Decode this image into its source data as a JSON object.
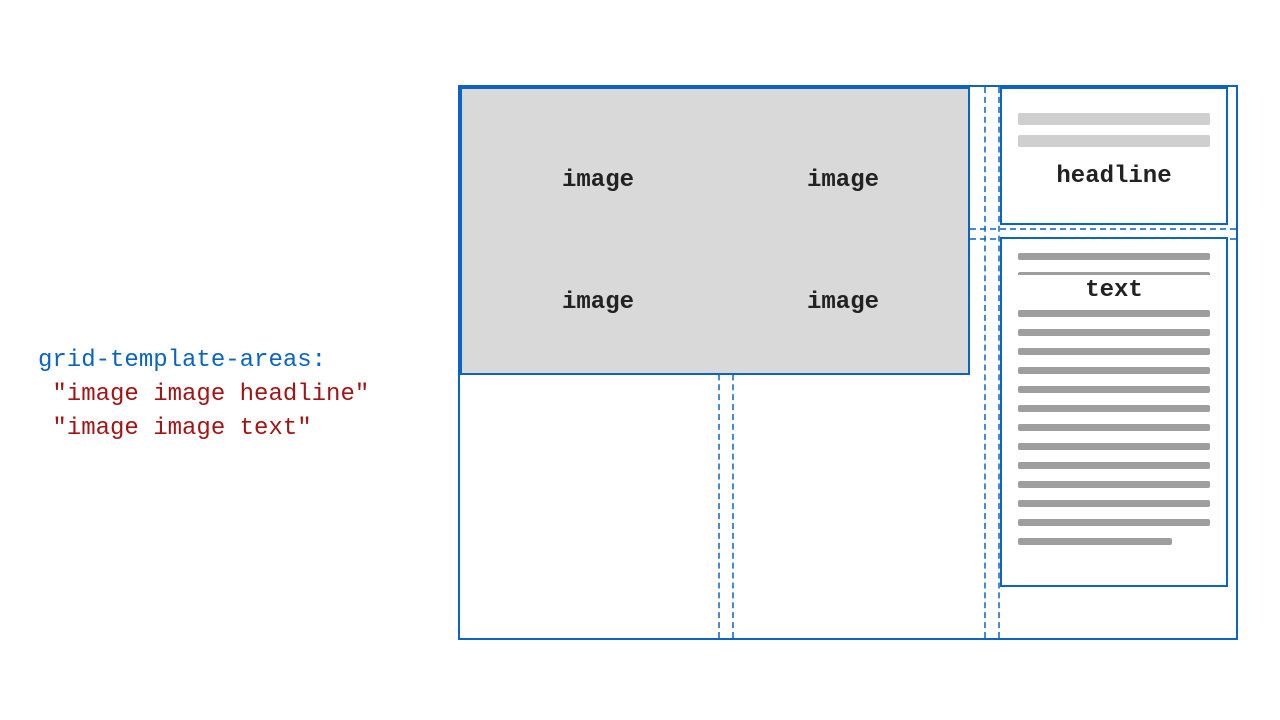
{
  "code": {
    "property": "grid-template-areas:",
    "row1": " \"image image headline\"",
    "row2": " \"image image text\""
  },
  "grid": {
    "cell_00": "image",
    "cell_01": "image",
    "cell_10": "image",
    "cell_11": "image",
    "headline_label": "headline",
    "text_label": "text"
  }
}
